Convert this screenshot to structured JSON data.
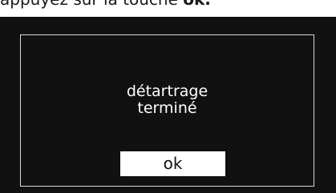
{
  "instruction": {
    "text": "appuyez sur la touche ",
    "key": "ok."
  },
  "dialog": {
    "line1": "détartrage",
    "line2": "terminé",
    "button_label": "ok"
  },
  "colors": {
    "screen_background": "#111111",
    "frame_border": "#d9d9d9",
    "text": "#ffffff",
    "button_background": "#ffffff"
  }
}
